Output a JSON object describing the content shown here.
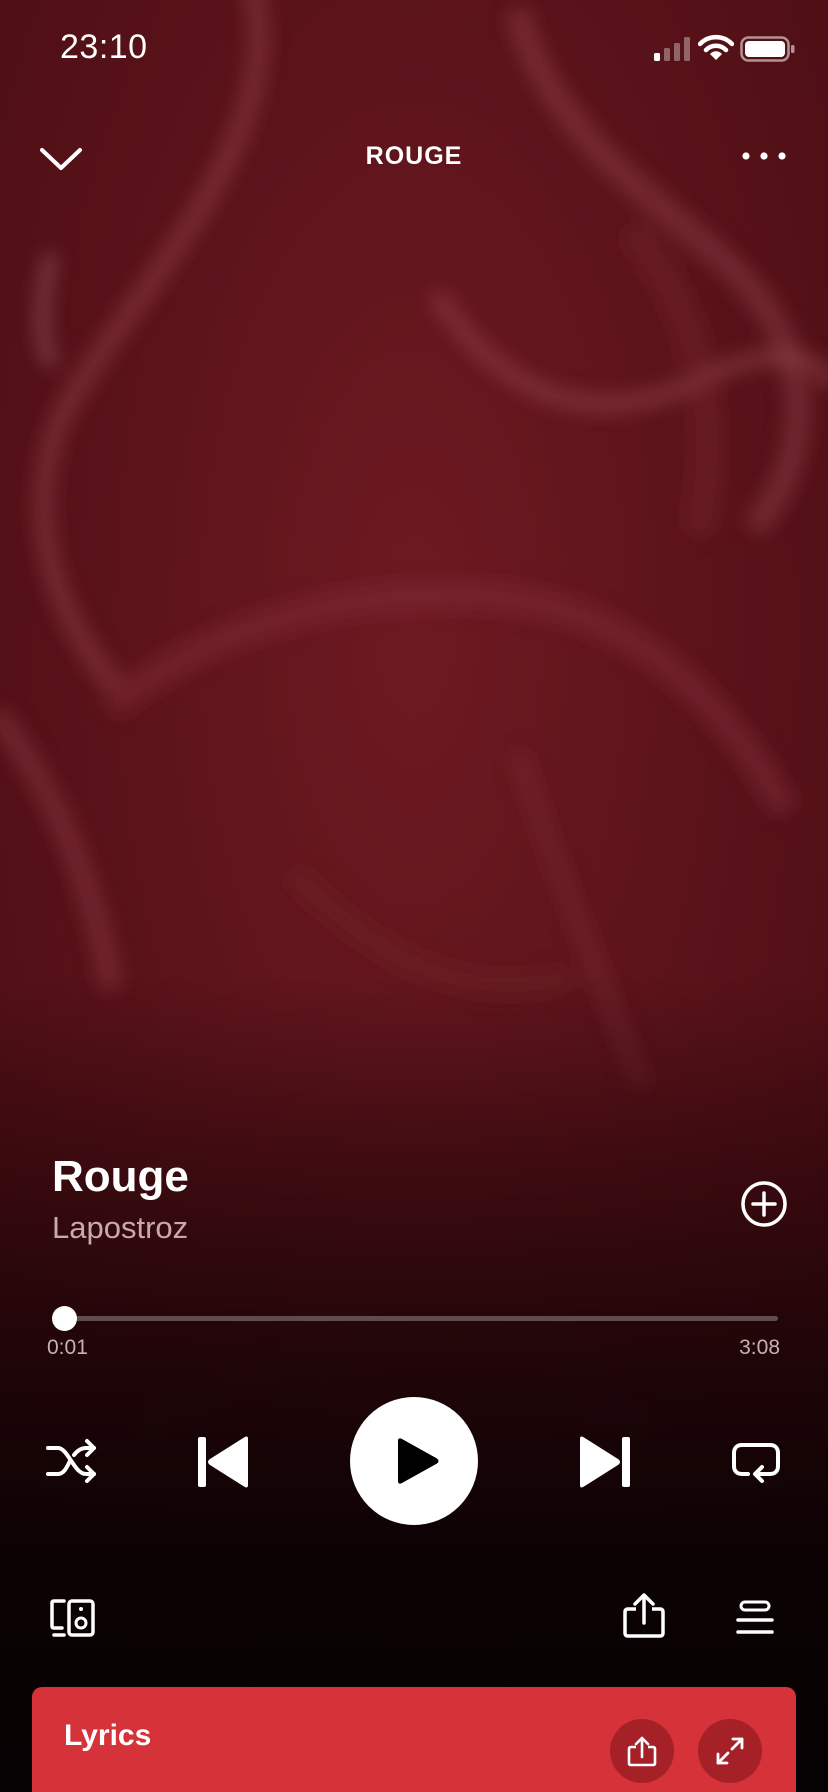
{
  "status_bar": {
    "time": "23:10"
  },
  "header": {
    "title": "ROUGE"
  },
  "track": {
    "title": "Rouge",
    "artist": "Lapostroz"
  },
  "playback": {
    "elapsed": "0:01",
    "total": "3:08",
    "progress_fraction": 0.005
  },
  "lyrics_card": {
    "label": "Lyrics"
  },
  "colors": {
    "background": "#5a1219",
    "lyrics_card": "#d5323a",
    "artist_text": "#c8a9ac"
  },
  "icons": {
    "collapse": "chevron-down-icon",
    "more": "more-horizontal-icon",
    "add": "add-circle-icon",
    "shuffle": "shuffle-icon",
    "previous": "skip-previous-icon",
    "play": "play-icon",
    "next": "skip-next-icon",
    "repeat": "repeat-icon",
    "devices": "connect-devices-icon",
    "share": "share-icon",
    "queue": "queue-icon",
    "expand": "expand-icon"
  }
}
